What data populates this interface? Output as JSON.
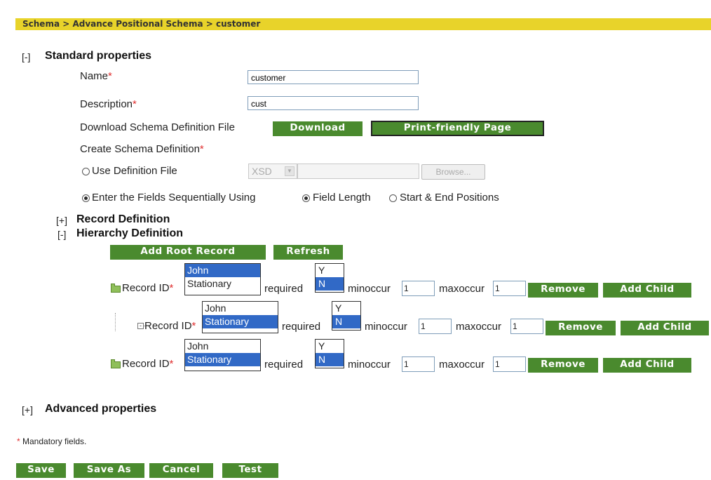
{
  "breadcrumb": "Schema > Advance Positional Schema > customer",
  "standard": {
    "toggle": "[-]",
    "title": "Standard properties",
    "name_label": "Name",
    "name_value": "customer",
    "desc_label": "Description",
    "desc_value": "cust",
    "download_label": "Download Schema Definition File",
    "download_btn": "Download",
    "print_btn": "Print-friendly Page",
    "create_label": "Create Schema Definition",
    "use_def_file": "Use Definition File",
    "format_value": "XSD",
    "browse_btn": "Browse...",
    "enter_fields": "Enter the Fields Sequentially Using",
    "field_length": "Field Length",
    "start_end": "Start & End Positions",
    "asterisk": "*"
  },
  "record_def": {
    "toggle": "[+]",
    "title": "Record Definition"
  },
  "hierarchy": {
    "toggle": "[-]",
    "title": "Hierarchy Definition",
    "add_root_btn": "Add Root Record",
    "refresh_btn": "Refresh",
    "rows": [
      {
        "label": "Record ID",
        "options": [
          "John",
          "Stationary"
        ],
        "required_label": "required",
        "yn": [
          "Y",
          "N"
        ],
        "minoccur_label": "minoccur",
        "minoccur": "1",
        "maxoccur_label": "maxoccur",
        "maxoccur": "1",
        "remove_btn": "Remove",
        "add_child_btn": "Add Child"
      },
      {
        "label": "Record ID",
        "options": [
          "John",
          "Stationary"
        ],
        "required_label": "required",
        "yn": [
          "Y",
          "N"
        ],
        "minoccur_label": "minoccur",
        "minoccur": "1",
        "maxoccur_label": "maxoccur",
        "maxoccur": "1",
        "remove_btn": "Remove",
        "add_child_btn": "Add Child"
      },
      {
        "label": "Record ID",
        "options": [
          "John",
          "Stationary"
        ],
        "required_label": "required",
        "yn": [
          "Y",
          "N"
        ],
        "minoccur_label": "minoccur",
        "minoccur": "1",
        "maxoccur_label": "maxoccur",
        "maxoccur": "1",
        "remove_btn": "Remove",
        "add_child_btn": "Add Child"
      }
    ]
  },
  "advanced": {
    "toggle": "[+]",
    "title": "Advanced properties"
  },
  "mandatory_note": "Mandatory fields.",
  "footer": {
    "save": "Save",
    "save_as": "Save As",
    "cancel": "Cancel",
    "test": "Test"
  },
  "colors": {
    "accent_green": "#4a8a2e",
    "breadcrumb_bg": "#e8d32a",
    "select_blue": "#3169c6",
    "required_red": "#e03030"
  }
}
